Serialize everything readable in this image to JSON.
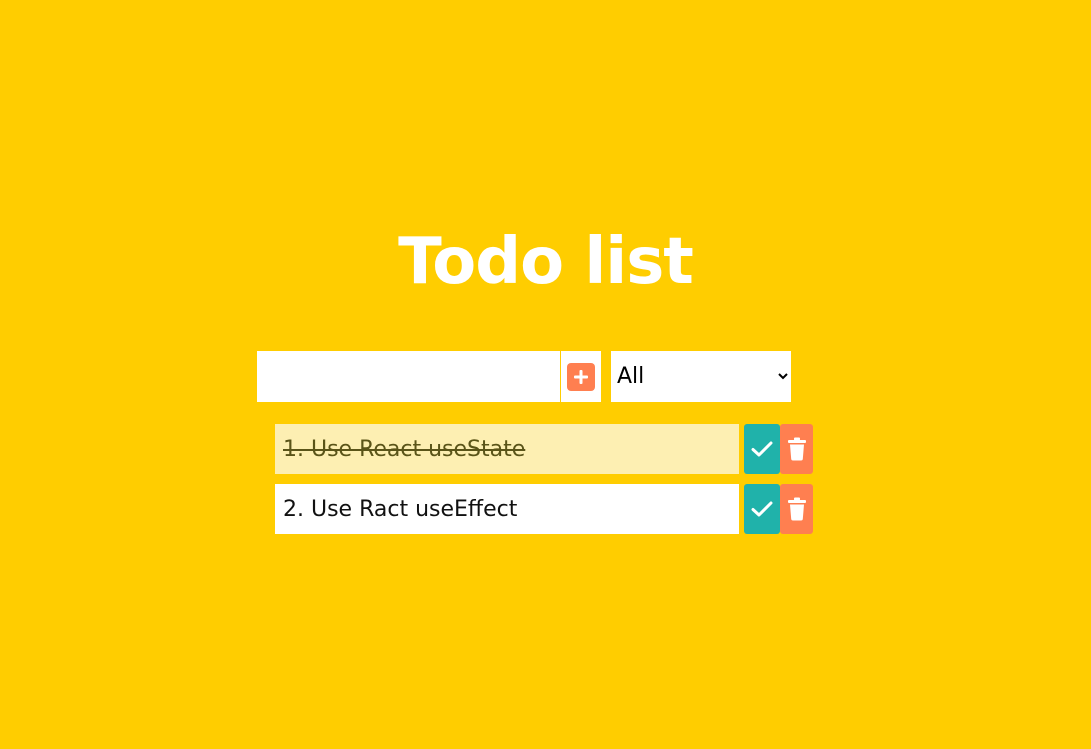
{
  "page": {
    "title": "Todo list"
  },
  "form": {
    "input_value": "",
    "add_icon": "plus-icon",
    "filter": {
      "selected": "All",
      "options": [
        "All"
      ]
    }
  },
  "todos": [
    {
      "text": "1. Use React useState",
      "completed": true
    },
    {
      "text": "2. Use Ract useEffect",
      "completed": false
    }
  ],
  "icons": {
    "complete": "check-icon",
    "delete": "trash-icon"
  },
  "colors": {
    "background": "#ffcd00",
    "accent_add": "#ff7f50",
    "complete_button": "#20b2aa",
    "delete_button": "#ff7f50",
    "completed_item_bg": "#fdefb2"
  }
}
